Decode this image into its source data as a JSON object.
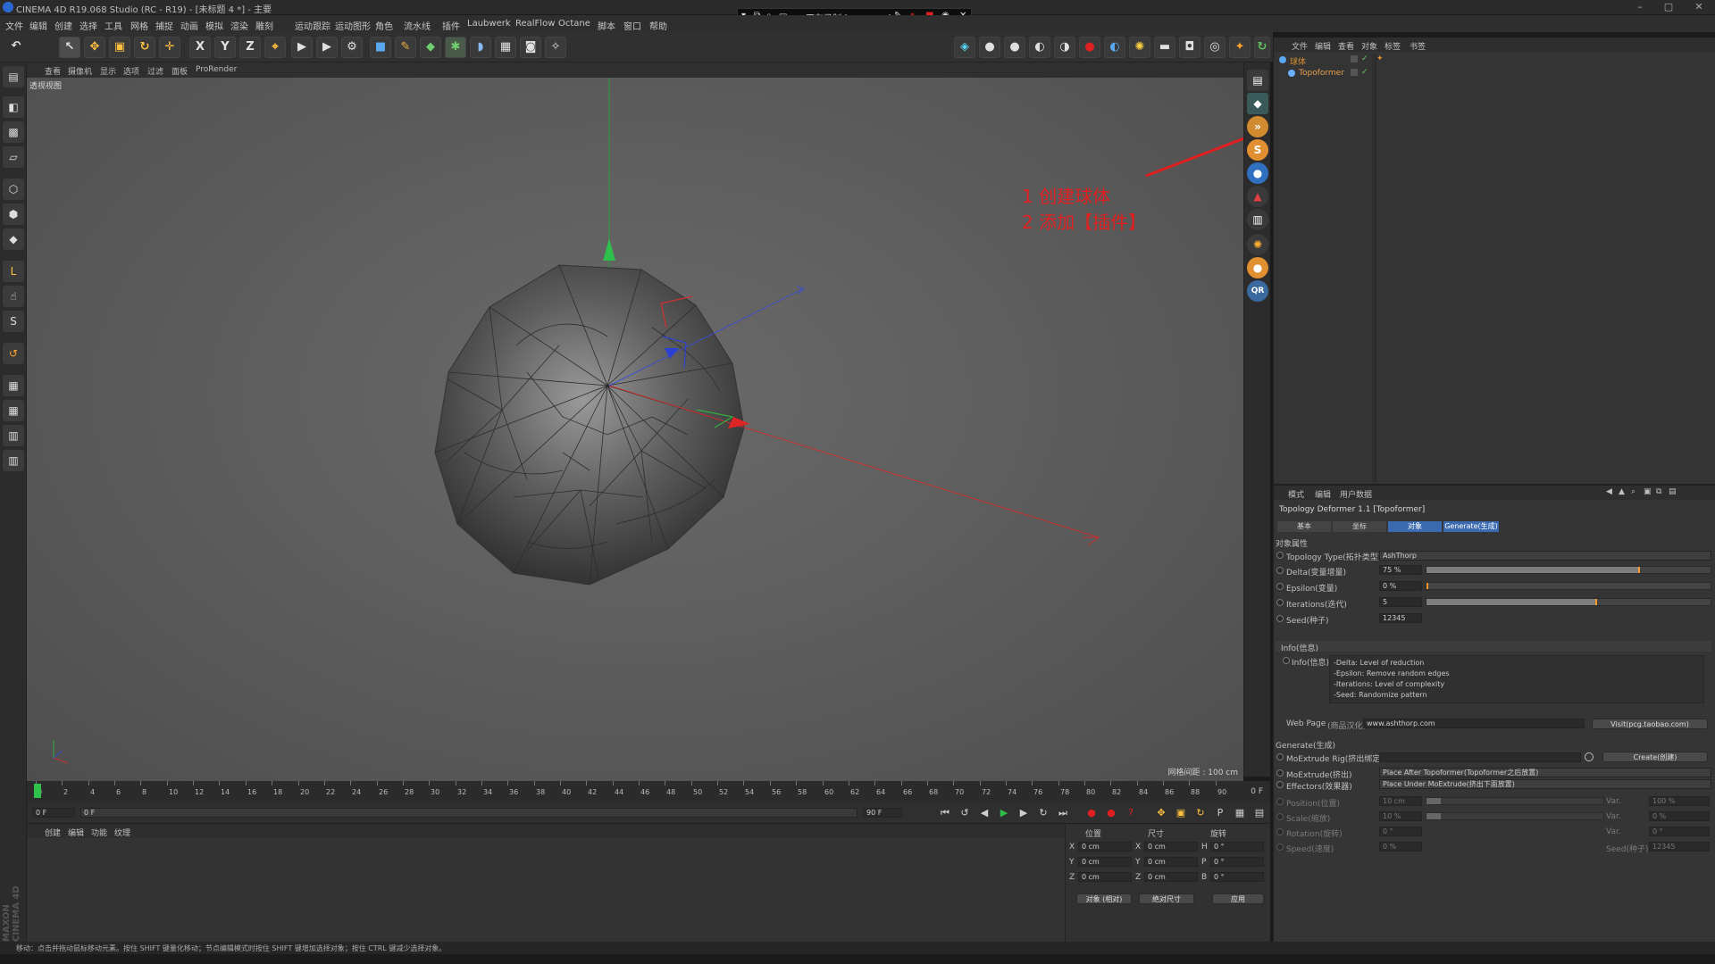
{
  "window": {
    "title": "CINEMA 4D R19.068 Studio (RC - R19) - [未标题 4 *] - 主要"
  },
  "recording": {
    "label": "正在录制 [00:03:04]"
  },
  "menubar": [
    "文件",
    "编辑",
    "创建",
    "选择",
    "工具",
    "网格",
    "捕捉",
    "动画",
    "模拟",
    "渲染",
    "雕刻",
    "运动跟踪",
    "运动图形",
    "角色",
    "流水线",
    "插件",
    "Laubwerk",
    "RealFlow",
    "Octane",
    "脚本",
    "窗口",
    "帮助"
  ],
  "toolbar": {
    "undo": "↶",
    "select": "↖",
    "move": "✥",
    "scale": "▣",
    "rotate": "↻",
    "last": "✛",
    "x": "X",
    "y": "Y",
    "z": "Z",
    "coord": "⌖"
  },
  "viewport": {
    "menu": [
      "查看",
      "摄像机",
      "显示",
      "选项",
      "过滤",
      "面板",
      "ProRender"
    ],
    "label": "透视视图",
    "grid_info": "网格间距 : 100 cm",
    "annotation": {
      "line1": "1 创建球体",
      "line2": "2 添加【插件】"
    }
  },
  "timeline": {
    "ticks": [
      "0",
      "2",
      "4",
      "6",
      "8",
      "10",
      "12",
      "14",
      "16",
      "18",
      "20",
      "22",
      "24",
      "26",
      "28",
      "30",
      "32",
      "34",
      "36",
      "38",
      "40",
      "42",
      "44",
      "46",
      "48",
      "50",
      "52",
      "54",
      "56",
      "58",
      "60",
      "62",
      "64",
      "66",
      "68",
      "70",
      "72",
      "74",
      "76",
      "78",
      "80",
      "82",
      "84",
      "86",
      "88",
      "90"
    ],
    "end_label": "0 F"
  },
  "playbar": {
    "start": "0 F",
    "cur": "0 F",
    "end": "90 F",
    "end2": "90 F"
  },
  "material_manager": {
    "menu": [
      "创建",
      "编辑",
      "功能",
      "纹理"
    ]
  },
  "coordinates": {
    "headers": [
      "位置",
      "尺寸",
      "旋转"
    ],
    "rows": [
      {
        "axis": "X",
        "pos": "0 cm",
        "size": "0 cm",
        "rot_label": "H",
        "rot": "0 °"
      },
      {
        "axis": "Y",
        "pos": "0 cm",
        "size": "0 cm",
        "rot_label": "P",
        "rot": "0 °"
      },
      {
        "axis": "Z",
        "pos": "0 cm",
        "size": "0 cm",
        "rot_label": "B",
        "rot": "0 °"
      }
    ],
    "mode1": "对象 (相对)",
    "mode2": "绝对尺寸",
    "apply": "应用"
  },
  "object_manager": {
    "menu": [
      "文件",
      "编辑",
      "查看",
      "对象",
      "标签",
      "书签"
    ],
    "objects": [
      {
        "name": "球体",
        "indent": 0,
        "color": "#d89030"
      },
      {
        "name": "Topoformer",
        "indent": 1,
        "color": "#e8a050"
      }
    ]
  },
  "attributes": {
    "menu": [
      "模式",
      "编辑",
      "用户数据"
    ],
    "title": "Topology Deformer 1.1 [Topoformer]",
    "tabs": [
      "基本",
      "坐标",
      "对象",
      "Generate(生成)"
    ],
    "section": "对象属性",
    "topology_type": {
      "label": "Topology Type(拓扑类型)",
      "value": "AshThorp"
    },
    "params": [
      {
        "label": "Delta(变量增量)",
        "value": "75 %",
        "fill": 0.75
      },
      {
        "label": "Epsilon(变量)",
        "value": "0 %",
        "fill": 0.0
      },
      {
        "label": "Iterations(迭代)",
        "value": "5",
        "fill": 0.6
      },
      {
        "label": "Seed(种子)",
        "value": "12345",
        "fill": null
      }
    ],
    "info": {
      "group": "Info(信息)",
      "label": "Info(信息)",
      "lines": [
        "-Delta: Level of reduction",
        "-Epsilon: Remove random edges",
        "-Iterations: Level of complexity",
        "-Seed: Randomize pattern"
      ]
    },
    "web_page": {
      "label": "Web Page",
      "prefix": "(商品汉化)",
      "url": "www.ashthorp.com",
      "button": "Visit(pcg.taobao.com)"
    },
    "generate": {
      "section": "Generate(生成)",
      "moextrude_rig": "MoExtrude Rig(挤出绑定)",
      "create_btn": "Create(创建)",
      "moextrude": {
        "label": "MoExtrude(挤出)",
        "value": "Place After Topoformer(Topoformer之后放置)"
      },
      "effectors": {
        "label": "Effectors(效果器)",
        "value": "Place Under MoExtrude(挤出下面放置)"
      },
      "rows": [
        {
          "label": "Position(位置)",
          "value": "10 cm",
          "var_label": "Var.",
          "var": "100 %"
        },
        {
          "label": "Scale(缩放)",
          "value": "10 %",
          "var_label": "Var.",
          "var": "0 %"
        },
        {
          "label": "Rotation(旋转)",
          "value": "0 °",
          "var_label": "Var.",
          "var": "0 °"
        },
        {
          "label": "Speed(速度)",
          "value": "0 %",
          "var_label": "Seed(种子)",
          "var": "12345"
        }
      ]
    }
  },
  "statusbar": {
    "text": "移动：点击并拖动鼠标移动元素。按住 SHIFT 键量化移动；节点编辑模式时按住 SHIFT 键增加选择对象；按住 CTRL 键减少选择对象。"
  },
  "branding": "MAXON CINEMA 4D"
}
